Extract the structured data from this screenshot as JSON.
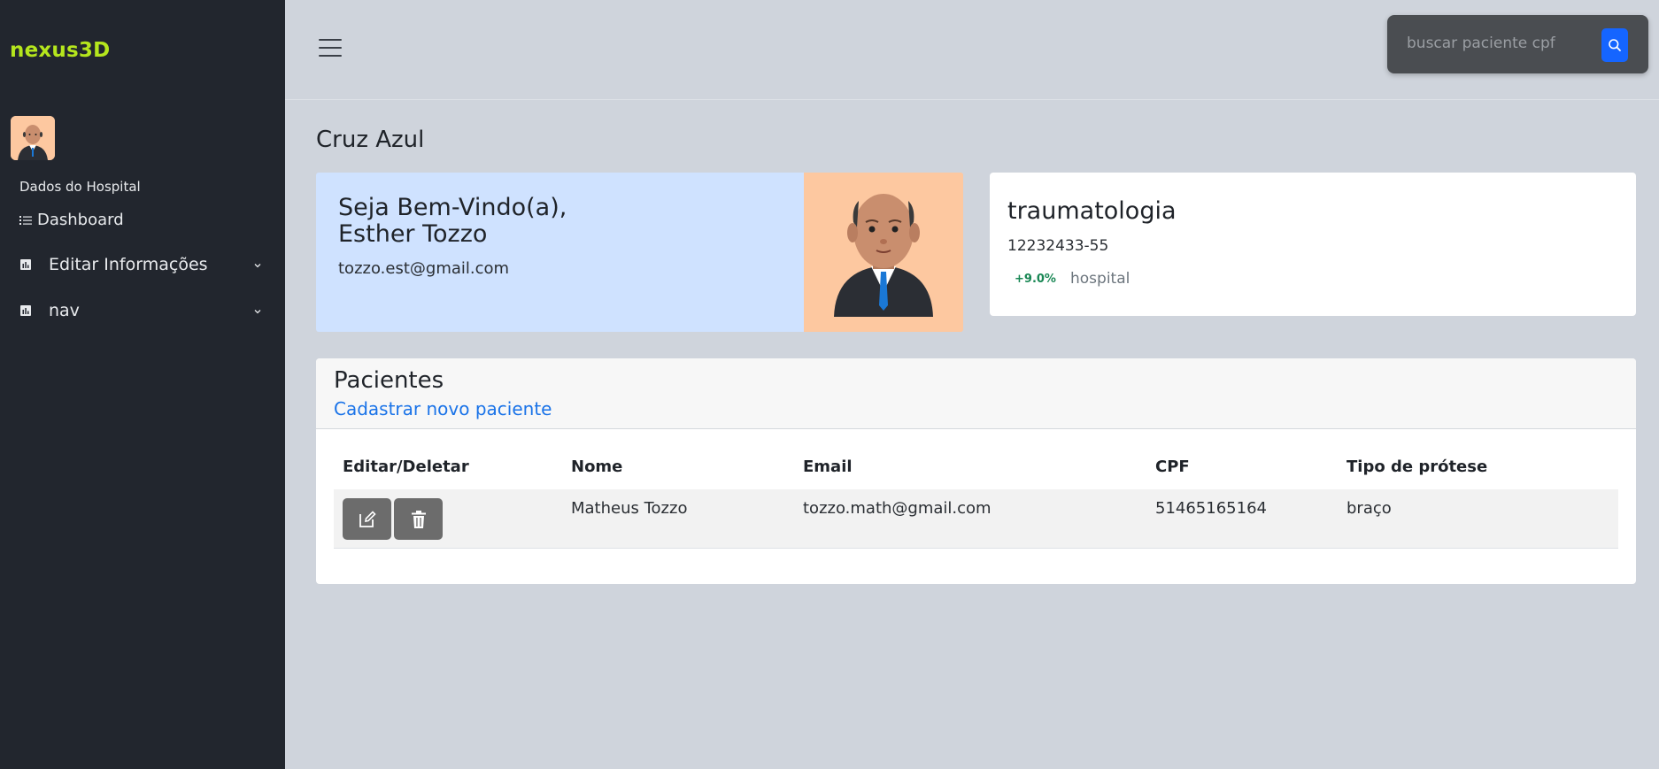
{
  "sidebar": {
    "logo": "nexus3D",
    "section_label": "Dados do Hospital",
    "items": [
      {
        "label": "Dashboard",
        "icon": "list-icon"
      },
      {
        "label": "Editar Informações",
        "icon": "chart-icon"
      },
      {
        "label": "nav",
        "icon": "chart-icon"
      }
    ]
  },
  "header": {
    "search_placeholder": "buscar paciente cpf"
  },
  "main": {
    "title": "Cruz Azul",
    "welcome": {
      "line1": "Seja Bem-Vindo(a),",
      "line2": "Esther Tozzo",
      "email": "tozzo.est@gmail.com"
    },
    "info": {
      "title": "traumatologia",
      "number": "12232433-55",
      "badge": "+9.0%",
      "subtitle": "hospital"
    },
    "patients": {
      "title": "Pacientes",
      "link": "Cadastrar novo paciente",
      "columns": [
        "Editar/Deletar",
        "Nome",
        "Email",
        "CPF",
        "Tipo de prótese"
      ],
      "rows": [
        {
          "name": "Matheus Tozzo",
          "email": "tozzo.math@gmail.com",
          "cpf": "51465165164",
          "type": "braço"
        }
      ]
    }
  },
  "colors": {
    "sidebar_bg": "#22262e",
    "logo": "#b5e61d",
    "page_bg": "#cfd4dc",
    "welcome_bg": "#cfe2ff",
    "avatar_bg": "#fdc8a0",
    "link": "#1a73e8",
    "search_button": "#1565ff",
    "badge_green": "#198754"
  }
}
